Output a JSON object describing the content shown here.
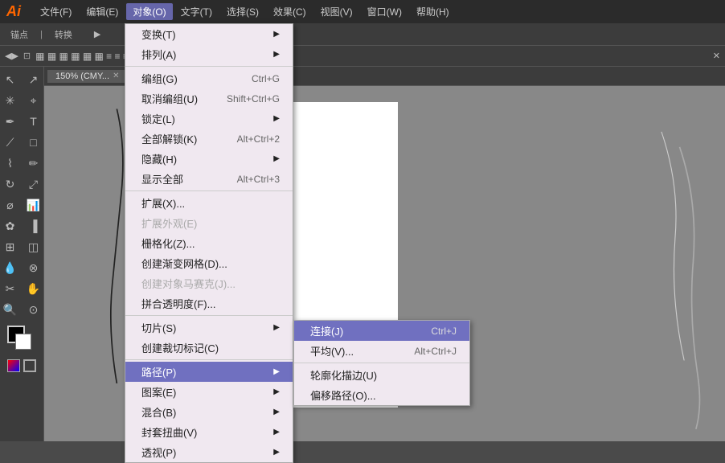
{
  "app": {
    "logo": "Ai",
    "title": "Adobe Illustrator"
  },
  "menubar": {
    "items": [
      {
        "label": "文件(F)",
        "id": "file"
      },
      {
        "label": "编辑(E)",
        "id": "edit"
      },
      {
        "label": "对象(O)",
        "id": "object",
        "active": true
      },
      {
        "label": "文字(T)",
        "id": "text"
      },
      {
        "label": "选择(S)",
        "id": "select"
      },
      {
        "label": "效果(C)",
        "id": "effect"
      },
      {
        "label": "视图(V)",
        "id": "view"
      },
      {
        "label": "窗口(W)",
        "id": "window"
      },
      {
        "label": "帮助(H)",
        "id": "help"
      }
    ]
  },
  "canvas_tab": {
    "label": "150% (CMY..."
  },
  "object_menu": {
    "items": [
      {
        "label": "变换(T)",
        "shortcut": "",
        "has_sub": true,
        "disabled": false
      },
      {
        "label": "排列(A)",
        "shortcut": "",
        "has_sub": true,
        "disabled": false
      },
      {
        "separator": true
      },
      {
        "label": "编组(G)",
        "shortcut": "Ctrl+G",
        "has_sub": false,
        "disabled": false
      },
      {
        "label": "取消编组(U)",
        "shortcut": "Shift+Ctrl+G",
        "has_sub": false,
        "disabled": false
      },
      {
        "label": "锁定(L)",
        "shortcut": "",
        "has_sub": true,
        "disabled": false
      },
      {
        "label": "全部解锁(K)",
        "shortcut": "Alt+Ctrl+2",
        "has_sub": false,
        "disabled": false
      },
      {
        "label": "隐藏(H)",
        "shortcut": "",
        "has_sub": true,
        "disabled": false
      },
      {
        "label": "显示全部",
        "shortcut": "Alt+Ctrl+3",
        "has_sub": false,
        "disabled": false
      },
      {
        "separator": true
      },
      {
        "label": "扩展(X)...",
        "shortcut": "",
        "has_sub": false,
        "disabled": false
      },
      {
        "label": "扩展外观(E)",
        "shortcut": "",
        "has_sub": false,
        "disabled": true
      },
      {
        "label": "栅格化(Z)...",
        "shortcut": "",
        "has_sub": false,
        "disabled": false
      },
      {
        "label": "创建渐变网格(D)...",
        "shortcut": "",
        "has_sub": false,
        "disabled": false
      },
      {
        "label": "创建对象马赛克(J)...",
        "shortcut": "",
        "has_sub": false,
        "disabled": false
      },
      {
        "label": "拼合透明度(F)...",
        "shortcut": "",
        "has_sub": false,
        "disabled": false
      },
      {
        "separator": true
      },
      {
        "label": "切片(S)",
        "shortcut": "",
        "has_sub": true,
        "disabled": false
      },
      {
        "label": "创建裁切标记(C)",
        "shortcut": "",
        "has_sub": false,
        "disabled": false
      },
      {
        "separator": true
      },
      {
        "label": "路径(P)",
        "shortcut": "",
        "has_sub": true,
        "disabled": false,
        "active": true
      },
      {
        "label": "图案(E)",
        "shortcut": "",
        "has_sub": true,
        "disabled": false
      },
      {
        "label": "混合(B)",
        "shortcut": "",
        "has_sub": true,
        "disabled": false
      },
      {
        "label": "封套扭曲(V)",
        "shortcut": "",
        "has_sub": true,
        "disabled": false
      },
      {
        "label": "透视(P)",
        "shortcut": "",
        "has_sub": true,
        "disabled": false
      }
    ]
  },
  "path_submenu": {
    "items": [
      {
        "label": "连接(J)",
        "shortcut": "Ctrl+J",
        "active": true
      },
      {
        "label": "平均(V)...",
        "shortcut": "Alt+Ctrl+J"
      },
      {
        "separator": true
      },
      {
        "label": "轮廓化描边(U)",
        "shortcut": ""
      },
      {
        "label": "偏移路径(O)...",
        "shortcut": ""
      }
    ]
  }
}
